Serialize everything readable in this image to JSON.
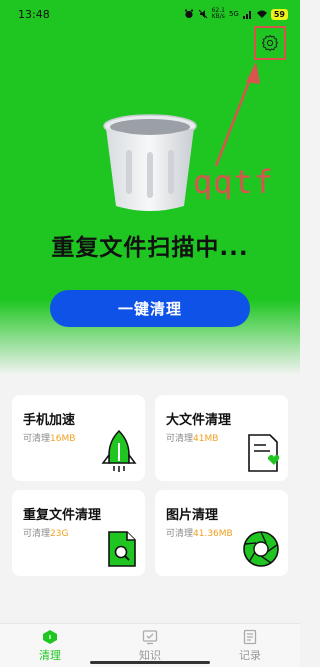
{
  "status_bar": {
    "time": "13:48",
    "net_speed_value": "62.1",
    "net_speed_unit": "KB/s",
    "network": "5G",
    "battery": "59"
  },
  "annotation": {
    "text": "qqtf"
  },
  "hero": {
    "title": "重复文件扫描中...",
    "clean_button": "一键清理"
  },
  "cards": [
    {
      "title": "手机加速",
      "sub_prefix": "可清理",
      "amount": "16MB",
      "icon": "rocket-icon"
    },
    {
      "title": "大文件清理",
      "sub_prefix": "可清理",
      "amount": "41MB",
      "icon": "file-heart-icon"
    },
    {
      "title": "重复文件清理",
      "sub_prefix": "可清理",
      "amount": "23G",
      "icon": "file-search-icon"
    },
    {
      "title": "图片清理",
      "sub_prefix": "可清理",
      "amount": "41.36MB",
      "icon": "aperture-icon"
    }
  ],
  "bottom_nav": [
    {
      "label": "清理",
      "icon": "clean-icon",
      "active": true
    },
    {
      "label": "知识",
      "icon": "knowledge-icon",
      "active": false
    },
    {
      "label": "记录",
      "icon": "record-icon",
      "active": false
    }
  ],
  "colors": {
    "brand_green": "#1fc622",
    "button_blue": "#0f52e8",
    "annotation_red": "#d9534f",
    "amount_orange": "#f0a020"
  }
}
